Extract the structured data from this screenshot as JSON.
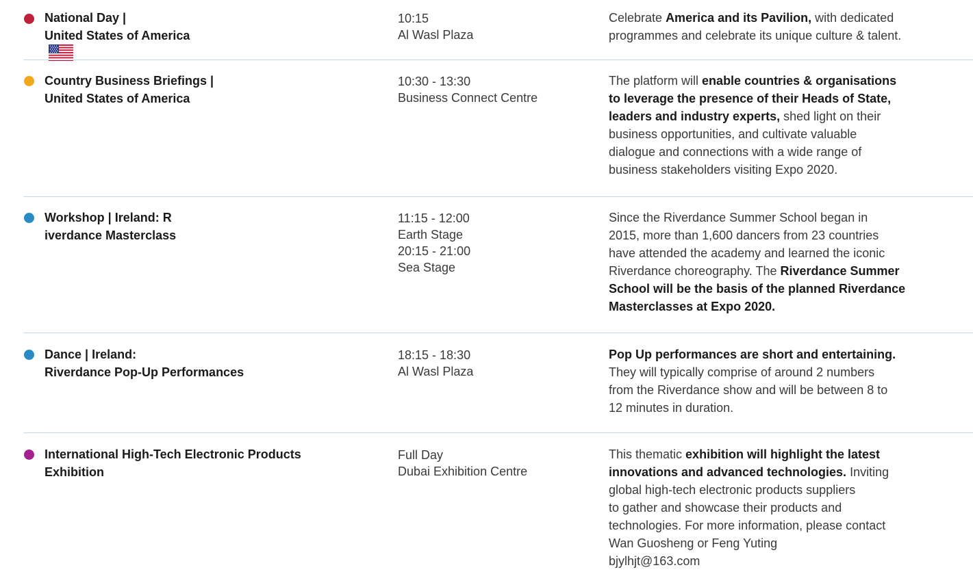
{
  "events": [
    {
      "dot_color": "#c0213a",
      "title_lines": [
        "National Day |",
        "United States of America"
      ],
      "flag_icon": "us-flag-icon",
      "time_lines": [
        "10:15",
        "Al Wasl Plaza"
      ],
      "desc_lines": [
        [
          {
            "t": "Celebrate ",
            "b": false
          },
          {
            "t": "America and its Pavilion,",
            "b": true
          },
          {
            "t": " with dedicated",
            "b": false
          }
        ],
        [
          {
            "t": "programmes and celebrate its unique culture & talent.",
            "b": false
          }
        ]
      ]
    },
    {
      "dot_color": "#f2a81d",
      "title_lines": [
        "Country Business Briefings |",
        "United States of America"
      ],
      "time_lines": [
        "10:30 - 13:30",
        "Business Connect Centre"
      ],
      "desc_lines": [
        [
          {
            "t": "The platform will ",
            "b": false
          },
          {
            "t": "enable countries & organisations",
            "b": true
          }
        ],
        [
          {
            "t": "to leverage the presence of their Heads of State,",
            "b": true
          }
        ],
        [
          {
            "t": "leaders and industry experts,",
            "b": true
          },
          {
            "t": " shed light on their",
            "b": false
          }
        ],
        [
          {
            "t": "business opportunities, and cultivate valuable",
            "b": false
          }
        ],
        [
          {
            "t": "dialogue and connections with a wide range of",
            "b": false
          }
        ],
        [
          {
            "t": "business stakeholders visiting Expo 2020.",
            "b": false
          }
        ]
      ]
    },
    {
      "dot_color": "#2a8ac6",
      "title_lines": [
        "Workshop | Ireland: R",
        "iverdance Masterclass"
      ],
      "time_lines": [
        "11:15 - 12:00",
        "Earth Stage",
        "20:15 - 21:00",
        "Sea Stage"
      ],
      "desc_lines": [
        [
          {
            "t": "Since the Riverdance Summer School began in",
            "b": false
          }
        ],
        [
          {
            "t": "2015, more than 1,600 dancers from 23 countries",
            "b": false
          }
        ],
        [
          {
            "t": "have attended the academy and learned the iconic",
            "b": false
          }
        ],
        [
          {
            "t": "Riverdance choreography. The ",
            "b": false
          },
          {
            "t": "Riverdance Summer",
            "b": true
          }
        ],
        [
          {
            "t": "School will be the basis of the planned Riverdance",
            "b": true
          }
        ],
        [
          {
            "t": "Masterclasses at Expo 2020.",
            "b": true
          }
        ]
      ]
    },
    {
      "dot_color": "#2a8ac6",
      "title_lines": [
        "Dance | Ireland:",
        "Riverdance Pop-Up Performances"
      ],
      "time_lines": [
        "18:15 - 18:30",
        "Al Wasl Plaza"
      ],
      "desc_lines": [
        [
          {
            "t": "Pop Up performances are short and entertaining.",
            "b": true
          }
        ],
        [
          {
            "t": "They will typically comprise of around 2 numbers",
            "b": false
          }
        ],
        [
          {
            "t": "from the Riverdance show and will be between 8 to",
            "b": false
          }
        ],
        [
          {
            "t": "12 minutes in duration.",
            "b": false
          }
        ]
      ]
    },
    {
      "dot_color": "#a3228f",
      "title_lines": [
        "International High-Tech Electronic Products",
        "Exhibition"
      ],
      "time_lines": [
        "Full Day",
        "Dubai Exhibition Centre"
      ],
      "desc_lines": [
        [
          {
            "t": "This thematic ",
            "b": false
          },
          {
            "t": "exhibition will highlight the latest",
            "b": true
          }
        ],
        [
          {
            "t": "innovations and advanced technologies.",
            "b": true
          },
          {
            "t": " Inviting",
            "b": false
          }
        ],
        [
          {
            "t": "global high-tech electronic products suppliers",
            "b": false
          }
        ],
        [
          {
            "t": "to gather and showcase their products and",
            "b": false
          }
        ],
        [
          {
            "t": "technologies. For more information, please contact",
            "b": false
          }
        ],
        [
          {
            "t": "Wan Guosheng or Feng Yuting",
            "b": false
          }
        ],
        [
          {
            "t": "bjylhjt@163.com",
            "b": false
          }
        ]
      ]
    }
  ]
}
